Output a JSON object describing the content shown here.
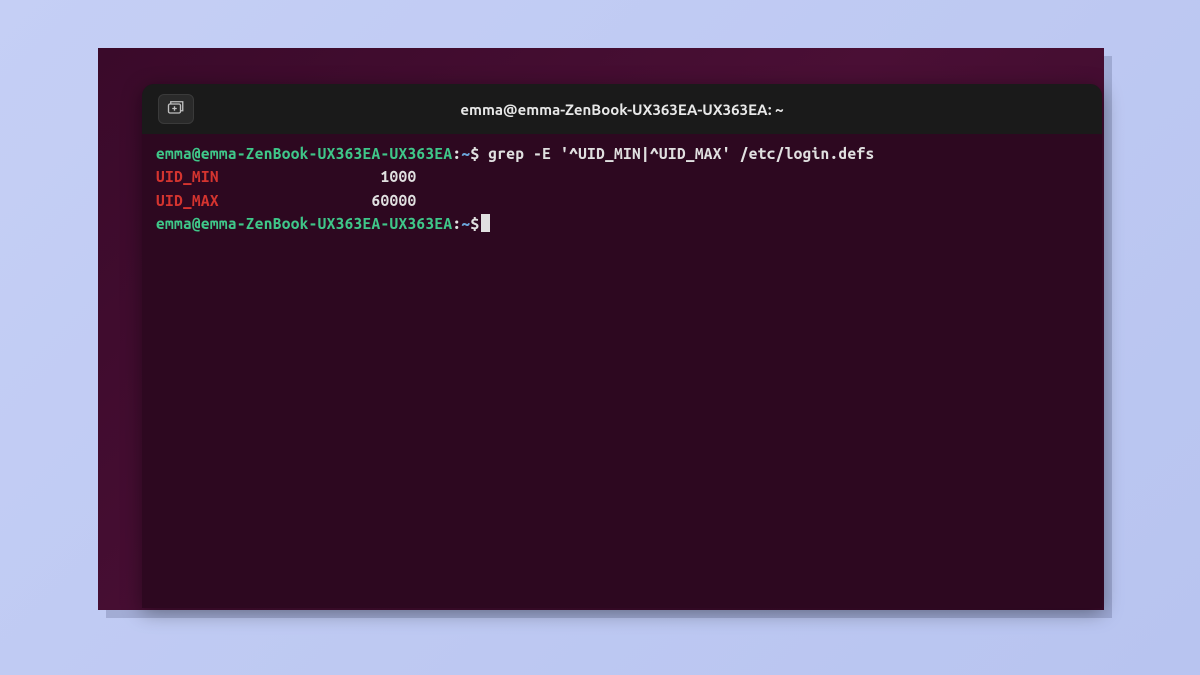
{
  "window": {
    "title": "emma@emma-ZenBook-UX363EA-UX363EA: ~"
  },
  "prompt": {
    "user_host": "emma@emma-ZenBook-UX363EA-UX363EA",
    "sep": ":",
    "path": "~",
    "symbol": "$"
  },
  "lines": {
    "command": " grep -E '^UID_MIN|^UID_MAX' /etc/login.defs",
    "out1_key": "UID_MIN",
    "out1_val": "\t\t\t 1000",
    "out2_key": "UID_MAX",
    "out2_val": "\t\t\t60000"
  },
  "icons": {
    "new_tab": "new-tab-icon"
  }
}
